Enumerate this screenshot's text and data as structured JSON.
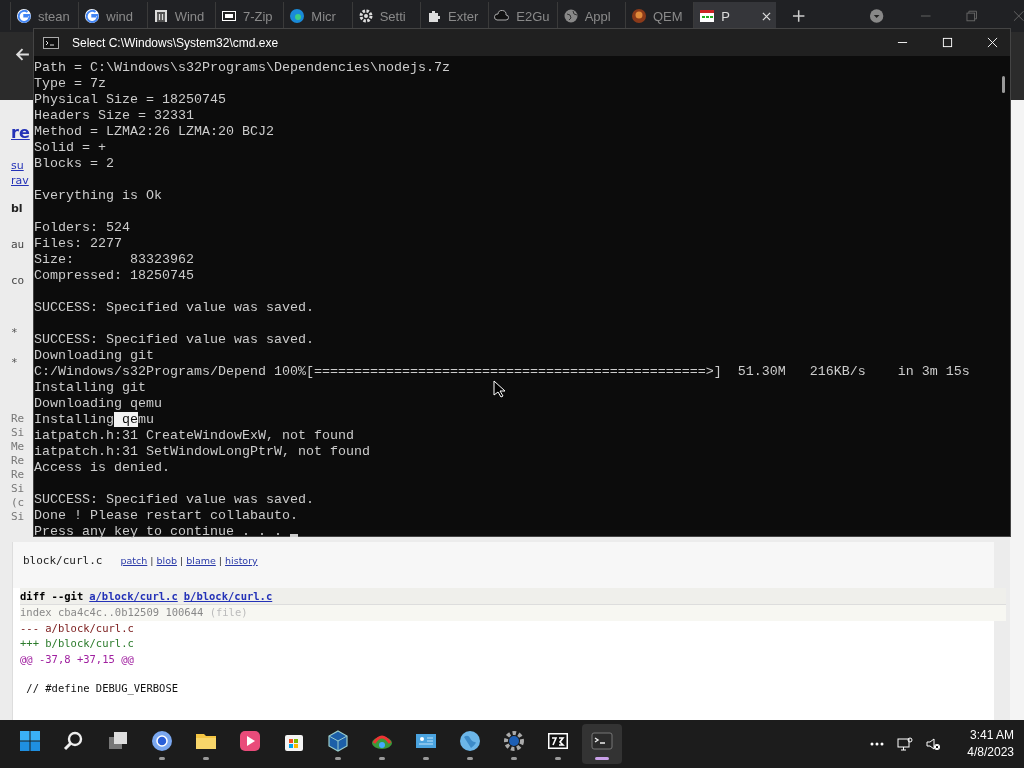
{
  "browser": {
    "tabs": [
      {
        "label": "stean",
        "selected": false
      },
      {
        "label": "wind",
        "selected": false
      },
      {
        "label": "Wind",
        "selected": false
      },
      {
        "label": "7-Zip",
        "selected": false
      },
      {
        "label": "Micr",
        "selected": false
      },
      {
        "label": "Setti",
        "selected": false
      },
      {
        "label": "Exter",
        "selected": false
      },
      {
        "label": "E2Gu",
        "selected": false
      },
      {
        "label": "Appl",
        "selected": false
      },
      {
        "label": "QEM",
        "selected": false
      },
      {
        "label": "P",
        "selected": true
      }
    ],
    "page_left_fragments": [
      {
        "kind": "title",
        "text": "re"
      },
      {
        "kind": "link",
        "text": "su"
      },
      {
        "kind": "link",
        "text": "rav"
      },
      {
        "kind": "heading",
        "text": "bl"
      },
      {
        "kind": "text",
        "text": "au"
      },
      {
        "kind": "text",
        "text": "co"
      },
      {
        "kind": "bullet",
        "text": "*"
      },
      {
        "kind": "bullet",
        "text": "*"
      },
      {
        "kind": "small",
        "text": "Re"
      },
      {
        "kind": "small",
        "text": "Si"
      },
      {
        "kind": "small",
        "text": "Me"
      },
      {
        "kind": "small",
        "text": "Re"
      },
      {
        "kind": "small",
        "text": "Re"
      },
      {
        "kind": "small",
        "text": "Si"
      },
      {
        "kind": "small",
        "text": "(c"
      },
      {
        "kind": "small",
        "text": "Si"
      }
    ],
    "file_row": {
      "path": "block/curl.c",
      "links": [
        "patch",
        "blob",
        "blame",
        "history"
      ],
      "separator": "|"
    },
    "diff": {
      "command": "diff --git",
      "a_link": "a/block/curl.c",
      "b_link": "b/block/curl.c",
      "lines": [
        {
          "kind": "index",
          "text": "index cba4c4c..0b12509 100644",
          "note": "(file)"
        },
        {
          "kind": "from",
          "text": "--- a/block/curl.c"
        },
        {
          "kind": "to",
          "text": "+++ b/block/curl.c"
        },
        {
          "kind": "chunk",
          "text": "@@ -37,8 +37,15 @@"
        },
        {
          "kind": "gap"
        },
        {
          "kind": "context",
          "text": " // #define DEBUG_VERBOSE"
        }
      ]
    }
  },
  "console": {
    "title": "Select C:\\Windows\\System32\\cmd.exe",
    "lines": [
      {
        "kind": "text",
        "text": "Path = C:\\Windows\\s32Programs\\Dependencies\\nodejs.7z"
      },
      {
        "kind": "text",
        "text": "Type = 7z"
      },
      {
        "kind": "text",
        "text": "Physical Size = 18250745"
      },
      {
        "kind": "text",
        "text": "Headers Size = 32331"
      },
      {
        "kind": "text",
        "text": "Method = LZMA2:26 LZMA:20 BCJ2"
      },
      {
        "kind": "text",
        "text": "Solid = +"
      },
      {
        "kind": "text",
        "text": "Blocks = 2"
      },
      {
        "kind": "blank"
      },
      {
        "kind": "text",
        "text": "Everything is Ok"
      },
      {
        "kind": "blank"
      },
      {
        "kind": "text",
        "text": "Folders: 524"
      },
      {
        "kind": "text",
        "text": "Files: 2277"
      },
      {
        "kind": "text",
        "text": "Size:       83323962"
      },
      {
        "kind": "text",
        "text": "Compressed: 18250745"
      },
      {
        "kind": "blank"
      },
      {
        "kind": "text",
        "text": "SUCCESS: Specified value was saved."
      },
      {
        "kind": "blank"
      },
      {
        "kind": "text",
        "text": "SUCCESS: Specified value was saved."
      },
      {
        "kind": "text",
        "text": "Downloading git"
      },
      {
        "kind": "text",
        "text": "C:/Windows/s32Programs/Depend 100%[=================================================>]  51.30M   216KB/s    in 3m 15s"
      },
      {
        "kind": "text",
        "text": "Installing git"
      },
      {
        "kind": "text",
        "text": "Downloading qemu"
      },
      {
        "kind": "segments",
        "segments": [
          {
            "text": "Installing",
            "selected": false
          },
          {
            "text": " qe",
            "selected": true
          },
          {
            "text": "mu",
            "selected": false
          }
        ]
      },
      {
        "kind": "text",
        "text": "iatpatch.h:31 CreateWindowExW, not found"
      },
      {
        "kind": "text",
        "text": "iatpatch.h:31 SetWindowLongPtrW, not found"
      },
      {
        "kind": "text",
        "text": "Access is denied."
      },
      {
        "kind": "blank"
      },
      {
        "kind": "text",
        "text": "SUCCESS: Specified value was saved."
      },
      {
        "kind": "text",
        "text": "Done ! Please restart collabauto."
      },
      {
        "kind": "text",
        "text": "Press any key to continue . . . ",
        "cursor": true
      }
    ]
  },
  "taskbar": {
    "apps": [
      {
        "running": false,
        "selected": false
      },
      {
        "running": false,
        "selected": false
      },
      {
        "running": false,
        "selected": false
      },
      {
        "running": true,
        "selected": false
      },
      {
        "running": true,
        "selected": false
      },
      {
        "running": false,
        "selected": false
      },
      {
        "running": false,
        "selected": false
      },
      {
        "running": true,
        "selected": false
      },
      {
        "running": true,
        "selected": false
      },
      {
        "running": true,
        "selected": false
      },
      {
        "running": true,
        "selected": false
      },
      {
        "running": true,
        "selected": false
      },
      {
        "running": true,
        "selected": false
      },
      {
        "running": true,
        "selected": true
      }
    ],
    "time": "3:41 AM",
    "date": "4/8/2023"
  }
}
